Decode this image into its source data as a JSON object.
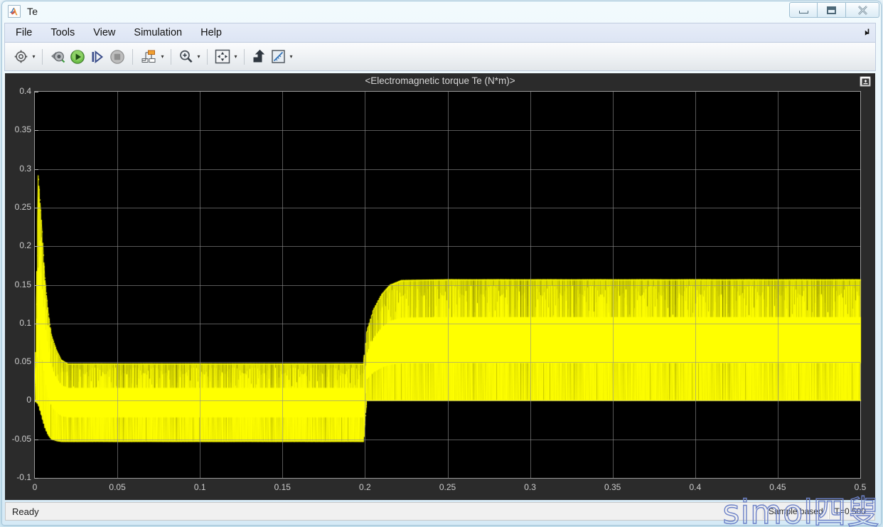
{
  "window": {
    "title": "Te",
    "icon": "matlab-icon",
    "controls": {
      "minimize": "minimize-icon",
      "maximize": "maximize-icon",
      "close": "close-icon"
    }
  },
  "menubar": {
    "items": [
      {
        "label": "File"
      },
      {
        "label": "Tools"
      },
      {
        "label": "View"
      },
      {
        "label": "Simulation"
      },
      {
        "label": "Help"
      }
    ],
    "dock_control": "undock-arrow-icon"
  },
  "toolbar": {
    "buttons": [
      {
        "name": "configuration-properties",
        "icon": "gear-icon",
        "has_caret": true
      },
      {
        "name": "connect-to-target",
        "icon": "connect-scope-icon",
        "has_caret": false
      },
      {
        "name": "run-simulation",
        "icon": "play-icon",
        "has_caret": false
      },
      {
        "name": "step-forward",
        "icon": "step-forward-icon",
        "has_caret": false
      },
      {
        "name": "stop-simulation",
        "icon": "stop-icon",
        "has_caret": false
      },
      {
        "name": "signal-selection",
        "icon": "signal-hierarchy-icon",
        "has_caret": true
      },
      {
        "name": "zoom",
        "icon": "magnifier-plus-icon",
        "has_caret": true
      },
      {
        "name": "autoscale",
        "icon": "autoscale-icon",
        "has_caret": true
      },
      {
        "name": "highlight-signal-in-model",
        "icon": "highlight-block-icon",
        "has_caret": false
      },
      {
        "name": "cursor-measurements",
        "icon": "ruler-icon",
        "has_caret": true
      }
    ]
  },
  "scope": {
    "title": "<Electromagnetic torque Te (N*m)>",
    "restore_button": "restore-icon",
    "background_color": "#000000",
    "panel_color": "#2b2b2b",
    "grid_color": "#8e8e8e",
    "trace_color": "#ffff00"
  },
  "chart_data": {
    "type": "line",
    "title": "<Electromagnetic torque Te (N*m)>",
    "xlabel": "",
    "ylabel": "",
    "xlim": [
      0,
      0.5
    ],
    "ylim": [
      -0.1,
      0.4
    ],
    "grid": true,
    "legend": "none",
    "x_ticks": [
      "0",
      "0.05",
      "0.1",
      "0.15",
      "0.2",
      "0.25",
      "0.3",
      "0.35",
      "0.4",
      "0.45",
      "0.5"
    ],
    "x_tick_values": [
      0,
      0.05,
      0.1,
      0.15,
      0.2,
      0.25,
      0.3,
      0.35,
      0.4,
      0.45,
      0.5
    ],
    "y_ticks": [
      "0.4",
      "0.35",
      "0.3",
      "0.25",
      "0.2",
      "0.15",
      "0.1",
      "0.05",
      "0",
      "-0.05",
      "-0.1"
    ],
    "y_tick_values": [
      0.4,
      0.35,
      0.3,
      0.25,
      0.2,
      0.15,
      0.1,
      0.05,
      0,
      -0.05,
      -0.1
    ],
    "series": [
      {
        "name": "Electromagnetic torque Te",
        "color": "#ffff00",
        "description": "PWM-chopped electromagnetic torque with startup transient, a low-load plateau, then a step load increase at t=0.2 s",
        "envelope": [
          {
            "t": 0.0,
            "min": 0.0,
            "max": 0.0
          },
          {
            "t": 0.002,
            "min": -0.005,
            "max": 0.292
          },
          {
            "t": 0.004,
            "min": -0.02,
            "max": 0.23
          },
          {
            "t": 0.006,
            "min": -0.035,
            "max": 0.16
          },
          {
            "t": 0.008,
            "min": -0.045,
            "max": 0.115
          },
          {
            "t": 0.01,
            "min": -0.05,
            "max": 0.085
          },
          {
            "t": 0.013,
            "min": -0.052,
            "max": 0.066
          },
          {
            "t": 0.016,
            "min": -0.053,
            "max": 0.053
          },
          {
            "t": 0.02,
            "min": -0.053,
            "max": 0.048
          },
          {
            "t": 0.05,
            "min": -0.053,
            "max": 0.048
          },
          {
            "t": 0.1,
            "min": -0.053,
            "max": 0.048
          },
          {
            "t": 0.15,
            "min": -0.053,
            "max": 0.048
          },
          {
            "t": 0.199,
            "min": -0.053,
            "max": 0.048
          },
          {
            "t": 0.201,
            "min": 0.0,
            "max": 0.09
          },
          {
            "t": 0.205,
            "min": 0.0,
            "max": 0.118
          },
          {
            "t": 0.21,
            "min": 0.0,
            "max": 0.138
          },
          {
            "t": 0.215,
            "min": 0.0,
            "max": 0.15
          },
          {
            "t": 0.222,
            "min": 0.0,
            "max": 0.156
          },
          {
            "t": 0.25,
            "min": 0.0,
            "max": 0.157
          },
          {
            "t": 0.3,
            "min": 0.0,
            "max": 0.157
          },
          {
            "t": 0.35,
            "min": 0.0,
            "max": 0.157
          },
          {
            "t": 0.4,
            "min": 0.0,
            "max": 0.157
          },
          {
            "t": 0.45,
            "min": 0.0,
            "max": 0.157
          },
          {
            "t": 0.5,
            "min": 0.0,
            "max": 0.157
          }
        ],
        "key_points": [
          {
            "label": "startup peak",
            "t": 0.002,
            "value": 0.292
          },
          {
            "label": "plateau upper",
            "t": 0.1,
            "value": 0.048
          },
          {
            "label": "plateau lower",
            "t": 0.1,
            "value": -0.053
          },
          {
            "label": "step time",
            "t": 0.2,
            "value": 0.0
          },
          {
            "label": "final upper",
            "t": 0.4,
            "value": 0.157
          },
          {
            "label": "final lower",
            "t": 0.4,
            "value": 0.0
          }
        ]
      }
    ]
  },
  "statusbar": {
    "ready_text": "Ready",
    "sample_mode": "Sample based",
    "time": "T=0.500"
  },
  "watermark": {
    "text": "simol四叟",
    "color": "#6d82c8"
  }
}
